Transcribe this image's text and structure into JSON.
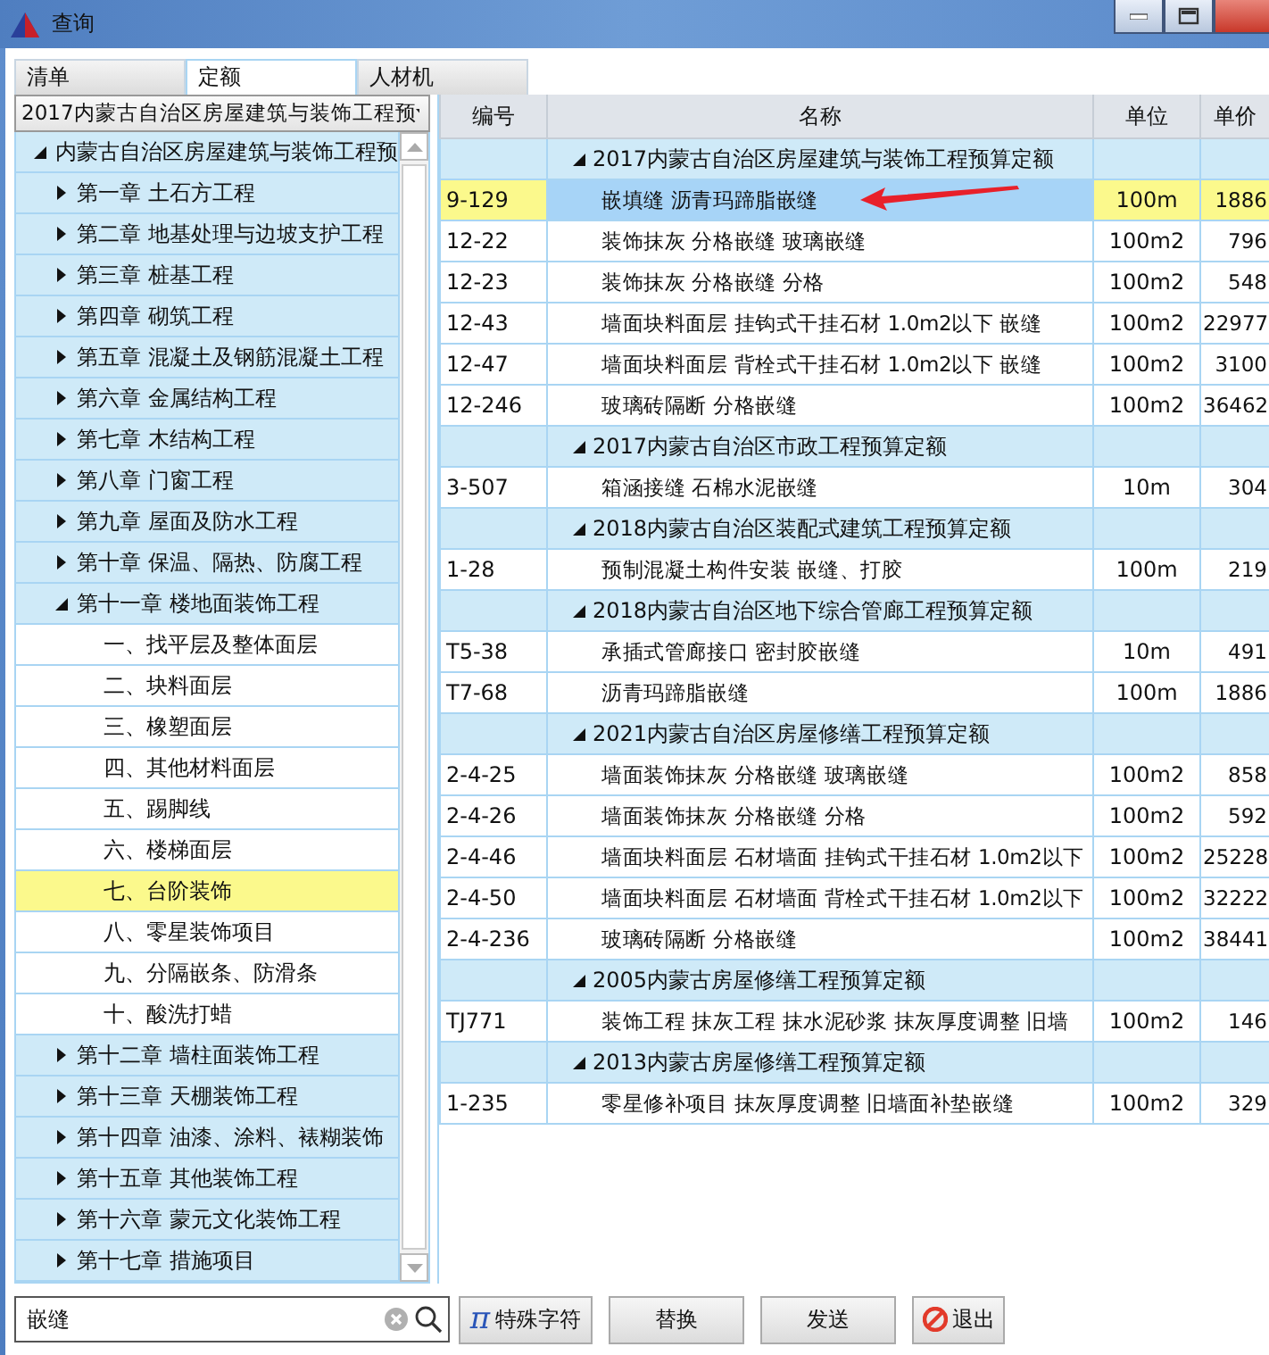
{
  "window": {
    "title": "查询"
  },
  "tabs": [
    {
      "label": "清单",
      "selected": false
    },
    {
      "label": "定额",
      "selected": true
    },
    {
      "label": "人材机",
      "selected": false
    }
  ],
  "library_dropdown": {
    "value": "2017内蒙古自治区房屋建筑与装饰工程预"
  },
  "tree": [
    {
      "label": "内蒙古自治区房屋建筑与装饰工程预",
      "expanded": true,
      "selected": false,
      "children": [
        {
          "label": "第一章 土石方工程",
          "expanded": false,
          "selected": false
        },
        {
          "label": "第二章 地基处理与边坡支护工程",
          "expanded": false,
          "selected": false
        },
        {
          "label": "第三章 桩基工程",
          "expanded": false,
          "selected": false
        },
        {
          "label": "第四章 砌筑工程",
          "expanded": false,
          "selected": false
        },
        {
          "label": "第五章 混凝土及钢筋混凝土工程",
          "expanded": false,
          "selected": false
        },
        {
          "label": "第六章 金属结构工程",
          "expanded": false,
          "selected": false
        },
        {
          "label": "第七章 木结构工程",
          "expanded": false,
          "selected": false
        },
        {
          "label": "第八章 门窗工程",
          "expanded": false,
          "selected": false
        },
        {
          "label": "第九章 屋面及防水工程",
          "expanded": false,
          "selected": false
        },
        {
          "label": "第十章 保温、隔热、防腐工程",
          "expanded": false,
          "selected": false
        },
        {
          "label": "第十一章 楼地面装饰工程",
          "expanded": true,
          "selected": false,
          "children": [
            {
              "label": "一、找平层及整体面层",
              "selected": false
            },
            {
              "label": "二、块料面层",
              "selected": false
            },
            {
              "label": "三、橡塑面层",
              "selected": false
            },
            {
              "label": "四、其他材料面层",
              "selected": false
            },
            {
              "label": "五、踢脚线",
              "selected": false
            },
            {
              "label": "六、楼梯面层",
              "selected": false
            },
            {
              "label": "七、台阶装饰",
              "selected": true
            },
            {
              "label": "八、零星装饰项目",
              "selected": false
            },
            {
              "label": "九、分隔嵌条、防滑条",
              "selected": false
            },
            {
              "label": "十、酸洗打蜡",
              "selected": false
            }
          ]
        },
        {
          "label": "第十二章 墙柱面装饰工程",
          "expanded": false,
          "selected": false
        },
        {
          "label": "第十三章 天棚装饰工程",
          "expanded": false,
          "selected": false
        },
        {
          "label": "第十四章 油漆、涂料、裱糊装饰",
          "expanded": false,
          "selected": false
        },
        {
          "label": "第十五章 其他装饰工程",
          "expanded": false,
          "selected": false
        },
        {
          "label": "第十六章 蒙元文化装饰工程",
          "expanded": false,
          "selected": false
        },
        {
          "label": "第十七章 措施项目",
          "expanded": false,
          "selected": false
        }
      ]
    }
  ],
  "table": {
    "columns": [
      "编号",
      "名称",
      "单位",
      "单价"
    ],
    "rows": [
      {
        "kind": "group",
        "name": "2017内蒙古自治区房屋建筑与装饰工程预算定额",
        "expanded": true
      },
      {
        "kind": "item",
        "code": "9-129",
        "name": "嵌填缝 沥青玛蹄脂嵌缝",
        "unit": "100m",
        "price": "1886",
        "selected": true
      },
      {
        "kind": "item",
        "code": "12-22",
        "name": "装饰抹灰 分格嵌缝 玻璃嵌缝",
        "unit": "100m2",
        "price": "796",
        "selected": false
      },
      {
        "kind": "item",
        "code": "12-23",
        "name": "装饰抹灰 分格嵌缝 分格",
        "unit": "100m2",
        "price": "548",
        "selected": false
      },
      {
        "kind": "item",
        "code": "12-43",
        "name": "墙面块料面层 挂钩式干挂石材 1.0m2以下 嵌缝",
        "unit": "100m2",
        "price": "22977",
        "selected": false
      },
      {
        "kind": "item",
        "code": "12-47",
        "name": "墙面块料面层 背栓式干挂石材 1.0m2以下 嵌缝",
        "unit": "100m2",
        "price": "3100",
        "selected": false
      },
      {
        "kind": "item",
        "code": "12-246",
        "name": "玻璃砖隔断 分格嵌缝",
        "unit": "100m2",
        "price": "36462",
        "selected": false
      },
      {
        "kind": "group",
        "name": "2017内蒙古自治区市政工程预算定额",
        "expanded": true
      },
      {
        "kind": "item",
        "code": "3-507",
        "name": "箱涵接缝 石棉水泥嵌缝",
        "unit": "10m",
        "price": "304",
        "selected": false
      },
      {
        "kind": "group",
        "name": "2018内蒙古自治区装配式建筑工程预算定额",
        "expanded": true
      },
      {
        "kind": "item",
        "code": "1-28",
        "name": "预制混凝土构件安装 嵌缝、打胶",
        "unit": "100m",
        "price": "219",
        "selected": false
      },
      {
        "kind": "group",
        "name": "2018内蒙古自治区地下综合管廊工程预算定额",
        "expanded": true
      },
      {
        "kind": "item",
        "code": "T5-38",
        "name": "承插式管廊接口 密封胶嵌缝",
        "unit": "10m",
        "price": "491",
        "selected": false
      },
      {
        "kind": "item",
        "code": "T7-68",
        "name": "沥青玛蹄脂嵌缝",
        "unit": "100m",
        "price": "1886",
        "selected": false
      },
      {
        "kind": "group",
        "name": "2021内蒙古自治区房屋修缮工程预算定额",
        "expanded": true
      },
      {
        "kind": "item",
        "code": "2-4-25",
        "name": "墙面装饰抹灰 分格嵌缝 玻璃嵌缝",
        "unit": "100m2",
        "price": "858",
        "selected": false
      },
      {
        "kind": "item",
        "code": "2-4-26",
        "name": "墙面装饰抹灰 分格嵌缝 分格",
        "unit": "100m2",
        "price": "592",
        "selected": false
      },
      {
        "kind": "item",
        "code": "2-4-46",
        "name": "墙面块料面层 石材墙面 挂钩式干挂石材 1.0m2以下",
        "unit": "100m2",
        "price": "25228",
        "selected": false
      },
      {
        "kind": "item",
        "code": "2-4-50",
        "name": "墙面块料面层 石材墙面 背栓式干挂石材 1.0m2以下",
        "unit": "100m2",
        "price": "32222",
        "selected": false
      },
      {
        "kind": "item",
        "code": "2-4-236",
        "name": "玻璃砖隔断 分格嵌缝",
        "unit": "100m2",
        "price": "38441",
        "selected": false
      },
      {
        "kind": "group",
        "name": "2005内蒙古房屋修缮工程预算定额",
        "expanded": true
      },
      {
        "kind": "item",
        "code": "TJ771",
        "name": "装饰工程 抹灰工程 抹水泥砂浆 抹灰厚度调整 旧墙",
        "unit": "100m2",
        "price": "146",
        "selected": false
      },
      {
        "kind": "group",
        "name": "2013内蒙古房屋修缮工程预算定额",
        "expanded": true
      },
      {
        "kind": "item",
        "code": "1-235",
        "name": "零星修补项目 抹灰厚度调整 旧墙面补垫嵌缝",
        "unit": "100m2",
        "price": "329",
        "selected": false
      }
    ]
  },
  "search": {
    "value": "嵌缝"
  },
  "buttons": [
    {
      "kind": "symbol",
      "symbol": "π",
      "label": "特殊字符"
    },
    {
      "kind": "plain",
      "label": "替换"
    },
    {
      "kind": "plain",
      "label": "发送"
    },
    {
      "kind": "exit",
      "label": "退出"
    }
  ]
}
